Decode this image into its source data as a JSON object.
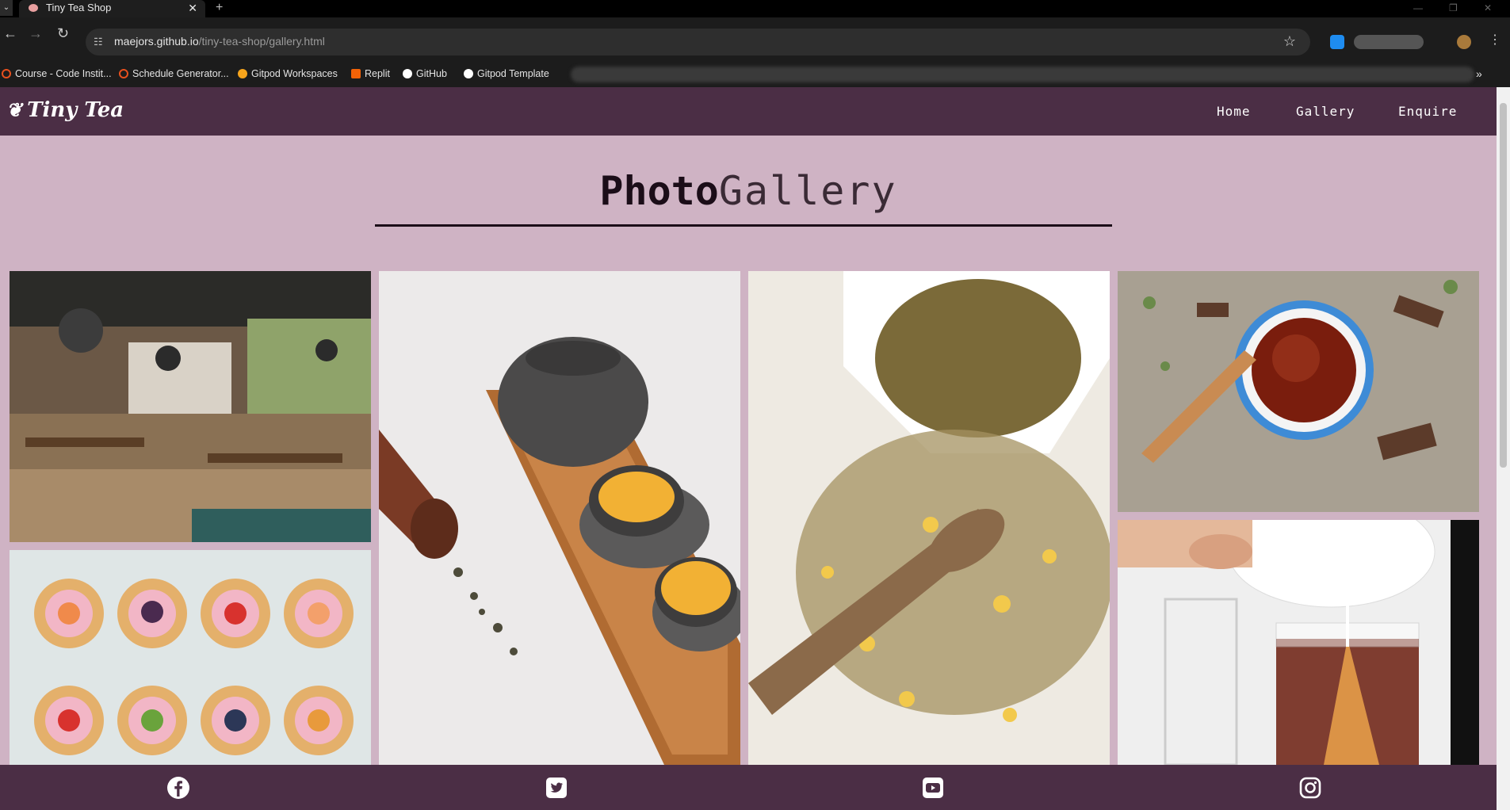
{
  "browser": {
    "tab_title": "Tiny Tea Shop",
    "tab_close": "✕",
    "new_tab": "+",
    "url_host": "maejors.github.io",
    "url_path": "/tiny-tea-shop/gallery.html",
    "bookmarks": [
      {
        "label": "Course - Code Instit...",
        "color": "#e8501e"
      },
      {
        "label": "Schedule Generator...",
        "color": "#e8501e"
      },
      {
        "label": "Gitpod Workspaces",
        "color": "#f7a51c"
      },
      {
        "label": "Replit",
        "color": "#f26207"
      },
      {
        "label": "GitHub",
        "color": "#ffffff"
      },
      {
        "label": "Gitpod Template",
        "color": "#ffffff"
      }
    ]
  },
  "site": {
    "logo": "Tiny Tea",
    "nav": [
      "Home",
      "Gallery",
      "Enquire"
    ],
    "heading_bold": "Photo",
    "heading_light": "Gallery",
    "colors": {
      "header": "#4b2e45",
      "background": "#cfb3c4"
    }
  },
  "gallery": {
    "photos": [
      "cafe-interior-photo",
      "fruit-tarts-photo",
      "teapot-tray-photo",
      "herbal-tea-leaves-photo",
      "tea-cup-spoon-photo",
      "pouring-tea-photo"
    ]
  },
  "footer": {
    "icons": [
      "facebook-icon",
      "twitter-icon",
      "youtube-icon",
      "instagram-icon"
    ]
  }
}
